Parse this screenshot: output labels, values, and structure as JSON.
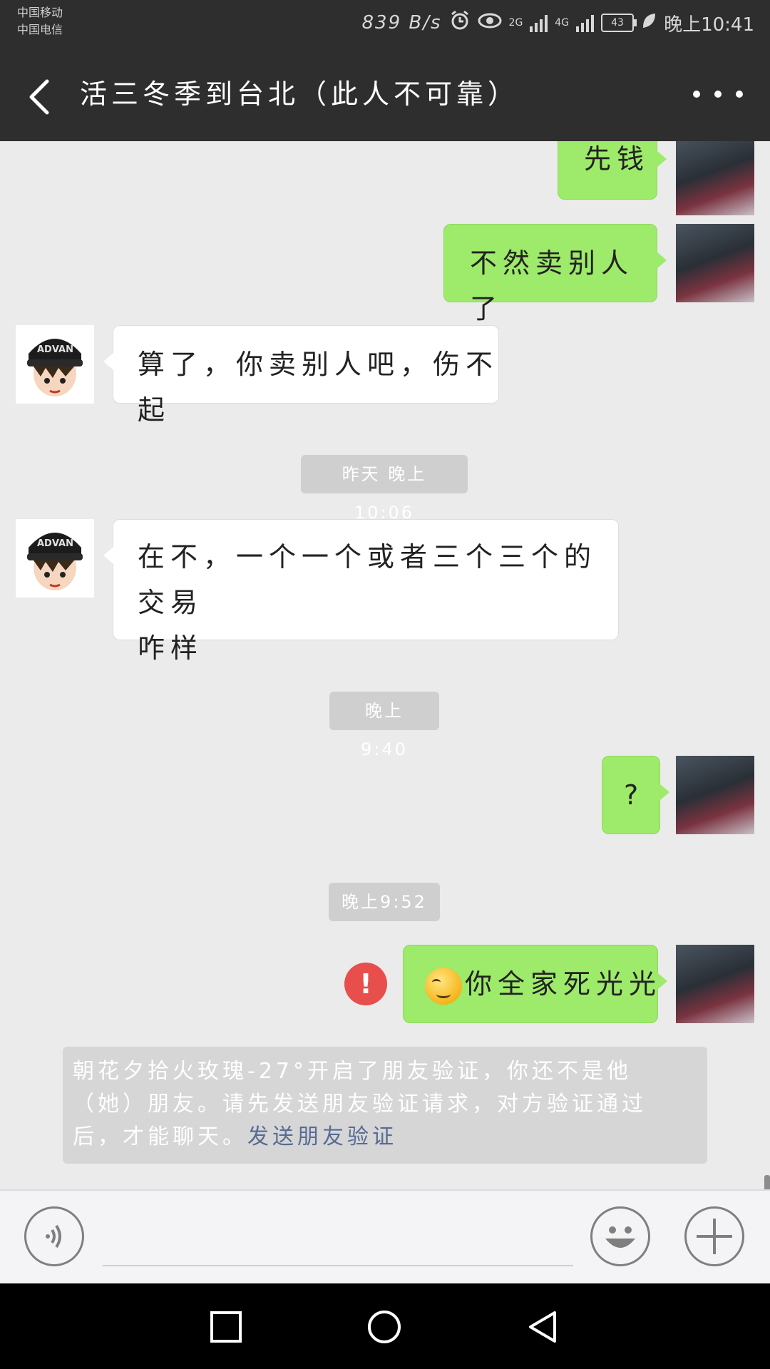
{
  "status_bar": {
    "carrier_1": "中国移动",
    "carrier_2": "中国电信",
    "net_speed": "839 B/s",
    "signal_2g": "2G",
    "signal_4g": "4G",
    "battery": "43",
    "time": "晚上10:41"
  },
  "title_bar": {
    "title": "活三冬季到台北（此人不可靠）"
  },
  "messages": [
    {
      "side": "self",
      "text": "先钱"
    },
    {
      "side": "self",
      "text": "不然卖别人了"
    },
    {
      "side": "other",
      "text": "算了，你卖别人吧，伤不起"
    },
    {
      "type": "time",
      "text": "昨天 晚上10:06"
    },
    {
      "side": "other",
      "text_line1": "在不，一个一个或者三个三个的交易",
      "text_line2": "咋样"
    },
    {
      "type": "time",
      "text": "晚上9:40"
    },
    {
      "side": "self",
      "text": "?"
    },
    {
      "type": "time",
      "text": "晚上9:52"
    },
    {
      "side": "self",
      "text": "你全家死光光",
      "failed": true
    }
  ],
  "system_notice": {
    "line1": "朝花夕拾火玫瑰-27°开启了朋友验证，你还不是他",
    "line2": "（她）朋友。请先发送朋友验证请求，对方验证通过",
    "line3": "后，才能聊天。",
    "link": "发送朋友验证"
  },
  "input_bar": {
    "text_value": ""
  },
  "icons": {
    "back": "chevron-left-icon",
    "more": "more-dots-icon",
    "voice": "voice-icon",
    "emoji": "smiley-icon",
    "plus": "plus-icon"
  },
  "colors": {
    "header": "#2e2e2e",
    "self_bubble": "#9eea6a",
    "other_bubble": "#ffffff",
    "error": "#e84e4c",
    "link": "#576b95"
  }
}
